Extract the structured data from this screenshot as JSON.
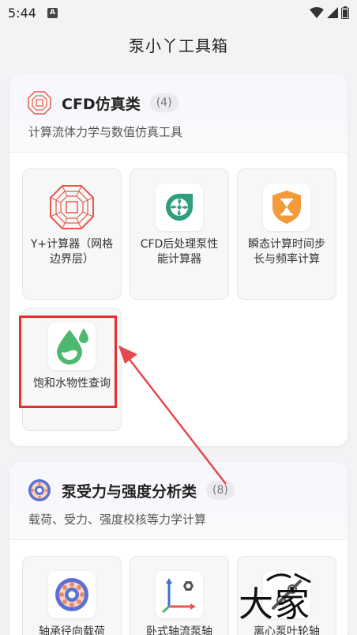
{
  "status_bar": {
    "time": "5:44",
    "notif_letter": "A"
  },
  "app": {
    "title": "泵小丫工具箱"
  },
  "sections": [
    {
      "title": "CFD仿真类",
      "count": "(4)",
      "subtitle": "计算流体力学与数值仿真工具",
      "tiles": [
        {
          "label": "Y+计算器（网格边界层）",
          "icon": "mesh-octagon-icon"
        },
        {
          "label": "CFD后处理泵性能计算器",
          "icon": "pump-fan-icon"
        },
        {
          "label": "瞬态计算时间步长与频率计算",
          "icon": "hourglass-shield-icon"
        },
        {
          "label": "饱和水物性查询",
          "icon": "water-drop-icon"
        }
      ]
    },
    {
      "title": "泵受力与强度分析类",
      "count": "(8)",
      "subtitle": "载荷、受力、强度校核等力学计算",
      "tiles": [
        {
          "label": "轴承径向载荷",
          "icon": "bearing-icon"
        },
        {
          "label": "卧式轴流泵轴",
          "icon": "axis-nut-icon"
        },
        {
          "label": "离心泵叶轮轴",
          "icon": "impeller-shaft-icon"
        }
      ]
    }
  ],
  "watermark": {
    "text": "大家"
  },
  "colors": {
    "highlight": "#e5302f",
    "accent_orange": "#f39a3a",
    "accent_green": "#4cb870",
    "accent_teal": "#2f9e7e"
  }
}
